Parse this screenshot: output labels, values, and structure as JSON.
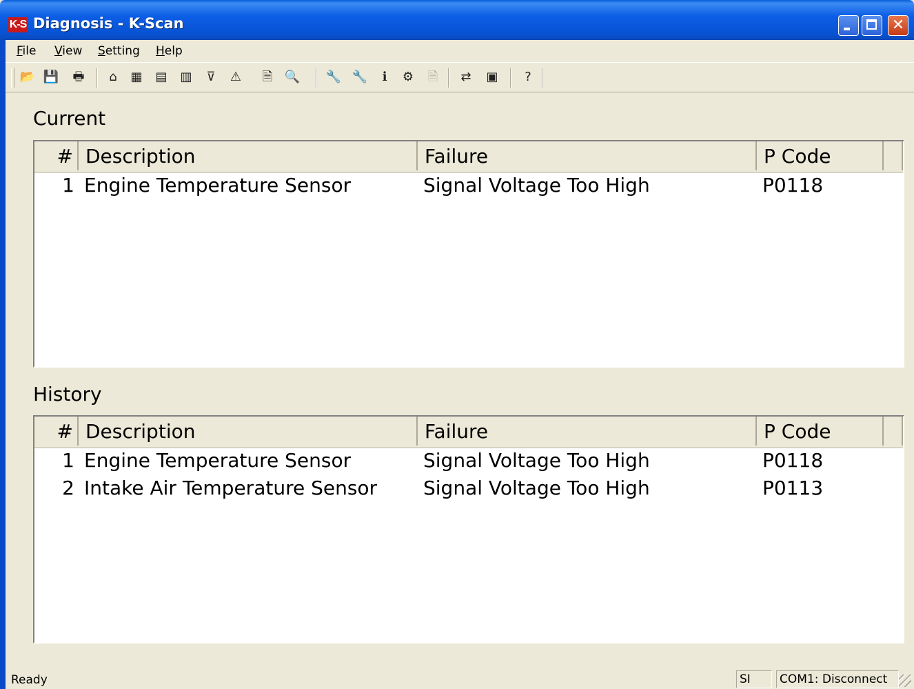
{
  "window": {
    "title": "Diagnosis - K-Scan",
    "app_icon": "K-S"
  },
  "menu": {
    "items": [
      "File",
      "View",
      "Setting",
      "Help"
    ]
  },
  "toolbar": {
    "buttons": [
      {
        "icon": "open-folder-icon",
        "glyph": "📂",
        "enabled": false
      },
      {
        "icon": "save-icon",
        "glyph": "💾",
        "enabled": true
      },
      {
        "icon": "print-icon",
        "glyph": "🖶",
        "enabled": true
      },
      {
        "icon": "home-icon",
        "glyph": "⌂",
        "enabled": true
      },
      {
        "icon": "grid-icon",
        "glyph": "▦",
        "enabled": true
      },
      {
        "icon": "list-icon",
        "glyph": "▤",
        "enabled": true
      },
      {
        "icon": "bar-chart-icon",
        "glyph": "▥",
        "enabled": true
      },
      {
        "icon": "filter-icon",
        "glyph": "⊽",
        "enabled": true
      },
      {
        "icon": "warning-icon",
        "glyph": "⚠",
        "enabled": true
      },
      {
        "icon": "report-icon",
        "glyph": "🗎",
        "enabled": true
      },
      {
        "icon": "preview-icon",
        "glyph": "🔍",
        "enabled": true
      },
      {
        "icon": "wrench-icon",
        "glyph": "🔧",
        "enabled": false
      },
      {
        "icon": "test-icon",
        "glyph": "🔧",
        "enabled": false
      },
      {
        "icon": "info-icon",
        "glyph": "ℹ",
        "enabled": true
      },
      {
        "icon": "adjust-icon",
        "glyph": "⚙",
        "enabled": true
      },
      {
        "icon": "program-icon",
        "glyph": "🗎",
        "enabled": false
      },
      {
        "icon": "data-icon",
        "glyph": "⇄",
        "enabled": true
      },
      {
        "icon": "window-icon",
        "glyph": "▣",
        "enabled": true
      },
      {
        "icon": "help-icon",
        "glyph": "?",
        "enabled": true
      }
    ]
  },
  "current": {
    "label": "Current",
    "columns": [
      "#",
      "Description",
      "Failure",
      "P Code"
    ],
    "rows": [
      {
        "num": "1",
        "description": "Engine Temperature Sensor",
        "failure": "Signal Voltage Too High",
        "pcode": "P0118"
      }
    ]
  },
  "history": {
    "label": "History",
    "columns": [
      "#",
      "Description",
      "Failure",
      "P Code"
    ],
    "rows": [
      {
        "num": "1",
        "description": "Engine Temperature Sensor",
        "failure": "Signal Voltage Too High",
        "pcode": "P0118"
      },
      {
        "num": "2",
        "description": "Intake Air Temperature Sensor",
        "failure": "Signal Voltage Too High",
        "pcode": "P0113"
      }
    ]
  },
  "status": {
    "text": "Ready",
    "unit": "SI",
    "connection": "COM1: Disconnect"
  },
  "colors": {
    "titlebar": "#0752d3",
    "face": "#ece9d8",
    "close": "#c43b17"
  }
}
